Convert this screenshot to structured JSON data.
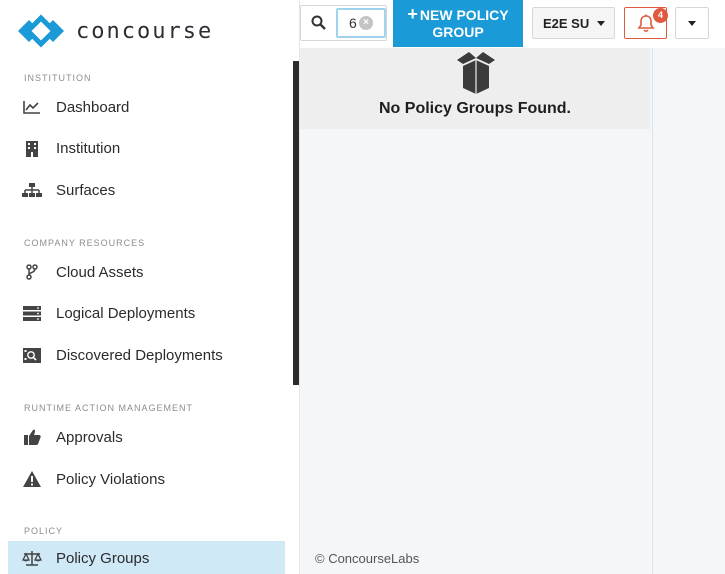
{
  "brand": {
    "name": "concourse"
  },
  "sidebar": {
    "sections": [
      {
        "label": "INSTITUTION"
      },
      {
        "label": "COMPANY RESOURCES"
      },
      {
        "label": "RUNTIME ACTION MANAGEMENT"
      },
      {
        "label": "POLICY"
      }
    ],
    "items": [
      {
        "label": "Dashboard",
        "icon": "line-chart-icon"
      },
      {
        "label": "Institution",
        "icon": "building-icon"
      },
      {
        "label": "Surfaces",
        "icon": "sitemap-icon"
      },
      {
        "label": "Cloud Assets",
        "icon": "code-fork-icon"
      },
      {
        "label": "Logical Deployments",
        "icon": "server-icon"
      },
      {
        "label": "Discovered Deployments",
        "icon": "discovered-server-icon"
      },
      {
        "label": "Approvals",
        "icon": "thumbs-up-icon"
      },
      {
        "label": "Policy Violations",
        "icon": "warning-icon"
      },
      {
        "label": "Policy Groups",
        "icon": "balance-scale-icon",
        "active": true
      }
    ]
  },
  "topbar": {
    "search_value": "6",
    "new_button_line1": "NEW POLICY",
    "new_button_line2": "GROUP",
    "org_selected": "E2E SU",
    "notification_count": "4"
  },
  "main": {
    "empty_message": "No Policy Groups Found.",
    "footer": "© ConcourseLabs"
  },
  "colors": {
    "accent": "#1a9ad6",
    "active_nav": "#cfe9f7",
    "alert": "#e05a3f"
  }
}
